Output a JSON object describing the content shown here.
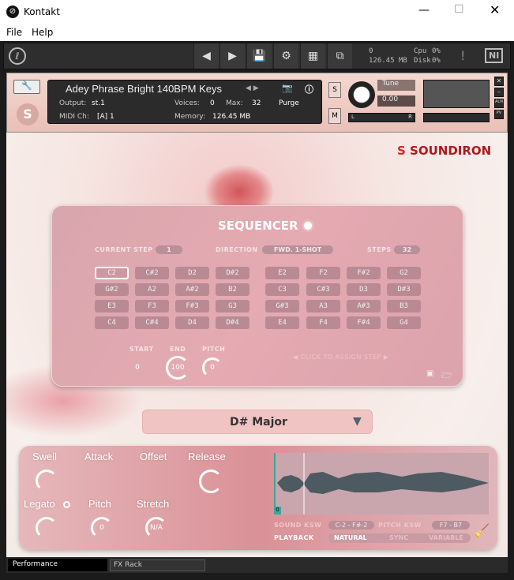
{
  "window": {
    "title": "Kontakt",
    "menu": [
      "File",
      "Help"
    ]
  },
  "toolbar": {
    "voices": "0",
    "memory": "126.45 MB",
    "cpu_label": "Cpu",
    "cpu": "0%",
    "disk_label": "Disk",
    "disk": "0%",
    "ni_logo": "NI"
  },
  "instrument": {
    "name": "Adey Phrase Bright 140BPM Keys",
    "output_label": "Output:",
    "output": "st.1",
    "voices_label": "Voices:",
    "voices": "0",
    "max_label": "Max:",
    "max": "32",
    "purge": "Purge",
    "midi_label": "MIDI Ch:",
    "midi": "[A] 1",
    "memory_label": "Memory:",
    "memory": "126.45 MB",
    "solo": "S",
    "mute": "M",
    "tune_label": "Tune",
    "tune": "0.00",
    "pan_l": "L",
    "pan_r": "R",
    "aux": "AUX",
    "pv": "PV"
  },
  "brand": "SOUNDIRON",
  "sequencer": {
    "title": "SEQUENCER",
    "current_step_label": "CURRENT STEP",
    "current_step": "1",
    "direction_label": "DIRECTION",
    "direction": "FWD. 1-SHOT",
    "steps_label": "STEPS",
    "steps": "32",
    "notes": [
      "C2",
      "C#2",
      "D2",
      "D#2",
      "E2",
      "F2",
      "F#2",
      "G2",
      "G#2",
      "A2",
      "A#2",
      "B2",
      "C3",
      "C#3",
      "D3",
      "D#3",
      "E3",
      "F3",
      "F#3",
      "G3",
      "G#3",
      "A3",
      "A#3",
      "B3",
      "C4",
      "C#4",
      "D4",
      "D#4",
      "E4",
      "F4",
      "F#4",
      "G4"
    ],
    "start_label": "START",
    "start": "0",
    "end_label": "END",
    "end": "100",
    "pitch_label": "PITCH",
    "pitch": "0",
    "assign": "◀ CLICK TO ASSIGN STEP ▶"
  },
  "scale": "D# Major",
  "controls": {
    "swell": "Swell",
    "attack": "Attack",
    "offset": "Offset",
    "release": "Release",
    "legato": "Legato",
    "pitch": "Pitch",
    "pitch_value": "0",
    "stretch": "Stretch",
    "stretch_value": "N/A",
    "marker": "0",
    "sound_ksw_label": "SOUND KSW",
    "sound_ksw": "C-2 - F#-2",
    "pitch_ksw_label": "PITCH KSW",
    "pitch_ksw": "F7 - B7",
    "playback_label": "PLAYBACK",
    "playback_options": [
      "NATURAL",
      "SYNC",
      "VARIABLE"
    ]
  },
  "tabs": [
    "Performance",
    "FX Rack"
  ]
}
